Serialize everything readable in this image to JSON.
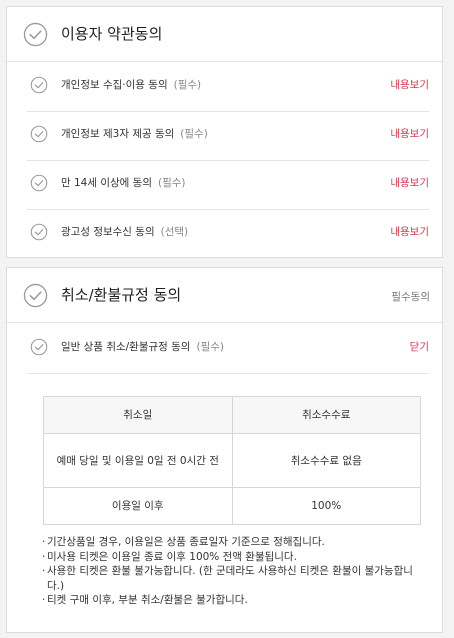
{
  "terms_panel": {
    "title": "이용자 약관동의",
    "items": [
      {
        "label": "개인정보 수집·이용 동의",
        "tag": "(필수)",
        "link": "내용보기"
      },
      {
        "label": "개인정보 제3자 제공 동의",
        "tag": "(필수)",
        "link": "내용보기"
      },
      {
        "label": "만 14세 이상에 동의",
        "tag": "(필수)",
        "link": "내용보기"
      },
      {
        "label": "광고성 정보수신 동의",
        "tag": "(선택)",
        "link": "내용보기"
      }
    ]
  },
  "refund_panel": {
    "title": "취소/환불규정 동의",
    "side_label": "필수동의",
    "item": {
      "label": "일반 상품 취소/환불규정 동의",
      "tag": "(필수)",
      "link": "닫기"
    },
    "table": {
      "headers": [
        "취소일",
        "취소수수료"
      ],
      "rows": [
        [
          "예매 당일 및 이용일 0일 전 0시간 전",
          "취소수수료 없음"
        ],
        [
          "이용일 이후",
          "100%"
        ]
      ]
    },
    "notes": [
      "기간상품일 경우, 이용일은 상품 종료일자 기준으로 정해집니다.",
      "미사용 티켓은 이용일 종료 이후 100% 전액 환불됩니다.",
      "사용한 티켓은 환불 불가능합니다. (한 군데라도 사용하신 티켓은 환불이 불가능합니다.)",
      "티켓 구매 이후, 부분 취소/환불은 불가합니다."
    ]
  },
  "colors": {
    "link": "#d43a52",
    "check": "#9a9a9a"
  },
  "icons": {
    "check": "check-circle-icon"
  }
}
